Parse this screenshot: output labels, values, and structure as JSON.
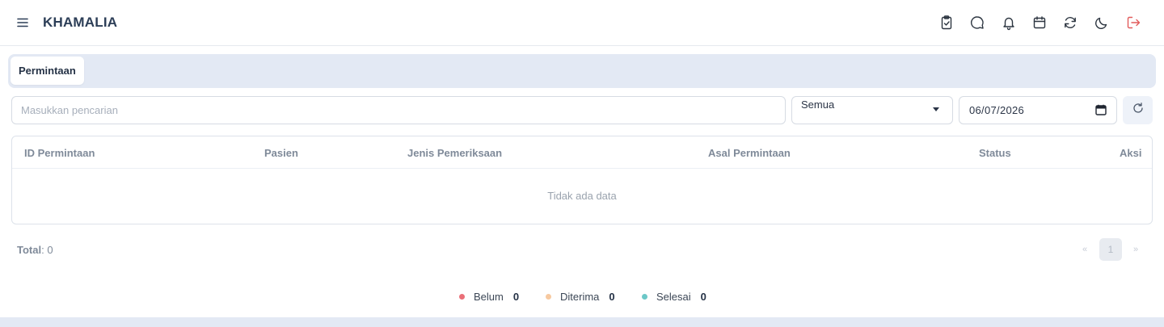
{
  "app": {
    "title": "KHAMALIA"
  },
  "header": {
    "icons": [
      "clipboard-check-icon",
      "chat-icon",
      "bell-icon",
      "calendar-icon",
      "refresh-icon",
      "moon-icon",
      "logout-icon"
    ]
  },
  "tabs": [
    {
      "label": "Permintaan"
    }
  ],
  "filters": {
    "search_placeholder": "Masukkan pencarian",
    "search_value": "",
    "status_selected": "Semua",
    "date_value": "06/07/2026"
  },
  "table": {
    "columns": [
      "ID Permintaan",
      "Pasien",
      "Jenis Pemeriksaan",
      "Asal Permintaan",
      "Status",
      "Aksi"
    ],
    "rows": [],
    "empty_text": "Tidak ada data"
  },
  "footer": {
    "total_label": "Total",
    "total_value": ": 0",
    "pagination": {
      "prev": "«",
      "current": "1",
      "next": "»"
    }
  },
  "legend": [
    {
      "label": "Belum",
      "count": "0",
      "color": "#ea6f78"
    },
    {
      "label": "Diterima",
      "count": "0",
      "color": "#f7c9a0"
    },
    {
      "label": "Selesai",
      "count": "0",
      "color": "#6cc8c8"
    }
  ],
  "colors": {
    "accent_bar": "#e3e9f4",
    "logout": "#e25b5b",
    "brand": "#2c3e57"
  }
}
